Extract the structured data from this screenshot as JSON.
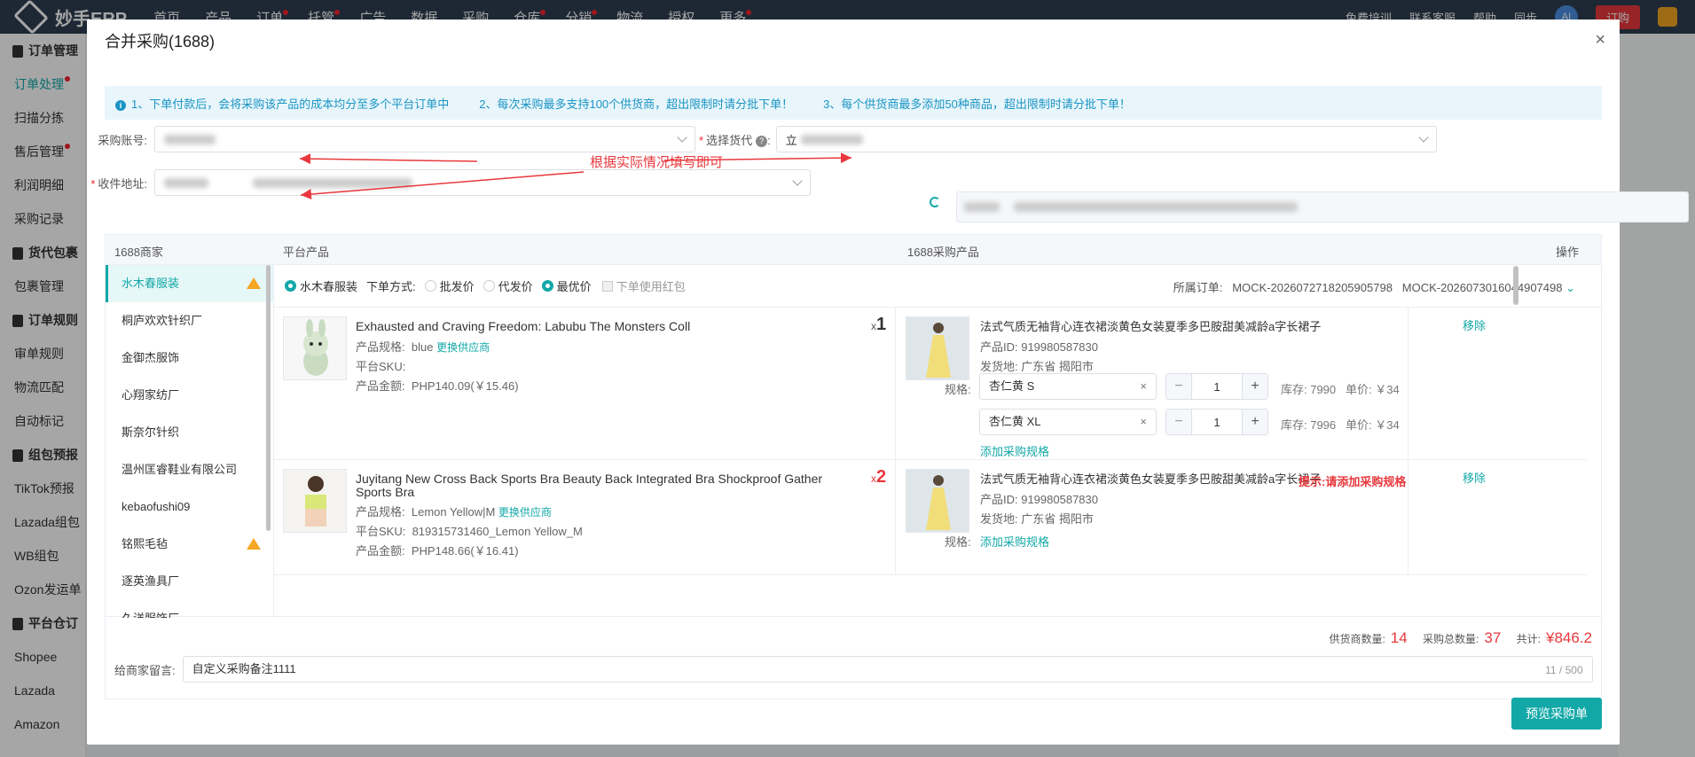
{
  "app": {
    "logo": "妙手ERP"
  },
  "topnav": [
    "首页",
    "产品",
    "订单",
    "托管",
    "广告",
    "数据",
    "采购",
    "仓库",
    "分销",
    "物流",
    "授权",
    "更多"
  ],
  "topright": {
    "train": "免费培训",
    "contact": "联系客服",
    "help": "帮助",
    "sync": "同步",
    "avatar": "AI",
    "order": "订购"
  },
  "sidebar": [
    {
      "label": "订单管理",
      "group": true
    },
    {
      "label": "订单处理",
      "active": true,
      "dot": true
    },
    {
      "label": "扫描分拣"
    },
    {
      "label": "售后管理",
      "dot": true
    },
    {
      "label": "利润明细"
    },
    {
      "label": "采购记录"
    },
    {
      "label": "货代包裹",
      "group": true
    },
    {
      "label": "包裹管理"
    },
    {
      "label": "订单规则",
      "group": true
    },
    {
      "label": "审单规则"
    },
    {
      "label": "物流匹配"
    },
    {
      "label": "自动标记"
    },
    {
      "label": "组包预报",
      "group": true
    },
    {
      "label": "TikTok预报"
    },
    {
      "label": "Lazada组包"
    },
    {
      "label": "WB组包"
    },
    {
      "label": "Ozon发运单"
    },
    {
      "label": "平台仓订",
      "group": true
    },
    {
      "label": "Shopee"
    },
    {
      "label": "Lazada"
    },
    {
      "label": "Amazon"
    }
  ],
  "modal": {
    "title": "合并采购(1688)",
    "close": "×",
    "notices": [
      "1、下单付款后，会将采购该产品的成本均分至多个平台订单中",
      "2、每次采购最多支持100个供货商，超出限制时请分批下单！",
      "3、每个供货商最多添加50种商品，超出限制时请分批下单！"
    ],
    "account_label": "采购账号:",
    "forwarder_label": "选择货代",
    "forwarder_value": "立",
    "address_label": "收件地址:",
    "annotation": "根据实际情况填写即可",
    "headers": {
      "merchant": "1688商家",
      "platform": "平台产品",
      "purchase": "1688采购产品",
      "action": "操作"
    },
    "merchants": [
      {
        "name": "水木春服装",
        "active": true,
        "warn": true
      },
      {
        "name": "桐庐欢欢针织厂"
      },
      {
        "name": "金御杰服饰"
      },
      {
        "name": "心翔家纺厂"
      },
      {
        "name": "斯奈尔针织"
      },
      {
        "name": "温州匡睿鞋业有限公司"
      },
      {
        "name": "kebaofushi09"
      },
      {
        "name": "铭熙毛毡",
        "warn": true
      },
      {
        "name": "逐英渔具厂"
      },
      {
        "name": "久洋服饰厂"
      }
    ],
    "toolbar": {
      "merchant": "水木春服装",
      "mode_label": "下单方式:",
      "opt1": "批发价",
      "opt2": "代发价",
      "opt3": "最优价",
      "redpack": "下单使用红包",
      "orders_label": "所属订单:",
      "order1": "MOCK-2026072718205905798",
      "order2": "MOCK-2026073016044907498"
    },
    "products": [
      {
        "title": "Exhausted and Craving Freedom: Labubu The Monsters Coll",
        "spec_label": "产品规格:",
        "spec": "blue",
        "change": "更换供应商",
        "sku_label": "平台SKU:",
        "sku": "",
        "amount_label": "产品金额:",
        "amount": "PHP140.09(￥15.46)",
        "qty_x": "x",
        "qty": "1",
        "p_title": "法式气质无袖背心连衣裙淡黄色女装夏季多巴胺甜美减龄a字长裙子",
        "p_id": "产品ID:  919980587830",
        "p_origin": "发货地:  广东省 揭阳市",
        "spec_row_label": "规格:",
        "specs": [
          {
            "name": "杏仁黄 S",
            "qty": "1",
            "stock": "库存: 7990",
            "price": "单价: ￥34"
          },
          {
            "name": "杏仁黄 XL",
            "qty": "1",
            "stock": "库存: 7996",
            "price": "单价: ￥34"
          }
        ],
        "add_spec": "添加采购规格",
        "remove": "移除"
      },
      {
        "title": "Juyitang New Cross Back Sports Bra Beauty Back Integrated Bra Shockproof Gather Sports Bra",
        "spec_label": "产品规格:",
        "spec": "Lemon Yellow|M",
        "change": "更换供应商",
        "sku_label": "平台SKU:",
        "sku": "819315731460_Lemon Yellow_M",
        "amount_label": "产品金额:",
        "amount": "PHP148.66(￥16.41)",
        "qty_x": "x",
        "qty": "2",
        "p_title": "法式气质无袖背心连衣裙淡黄色女装夏季多巴胺甜美减龄a字长裙子",
        "p_id": "产品ID:  919980587830",
        "p_origin": "发货地:  广东省 揭阳市",
        "spec_row_label": "规格:",
        "add_spec": "添加采购规格",
        "hint": "提示:请添加采购规格",
        "remove": "移除"
      }
    ],
    "summary": {
      "supplier_label": "供货商数量:",
      "supplier_count": "14",
      "total_label": "采购总数量:",
      "total_count": "37",
      "sum_label": "共计:",
      "sum": "¥846.2"
    },
    "message_label": "给商家留言:",
    "message_value": "自定义采购备注1111",
    "message_count": "11 / 500",
    "preview_button": "预览采购单"
  },
  "colors": {
    "accent": "#13a8a8",
    "danger": "#e8383d",
    "topbar": "#2d3e50"
  }
}
